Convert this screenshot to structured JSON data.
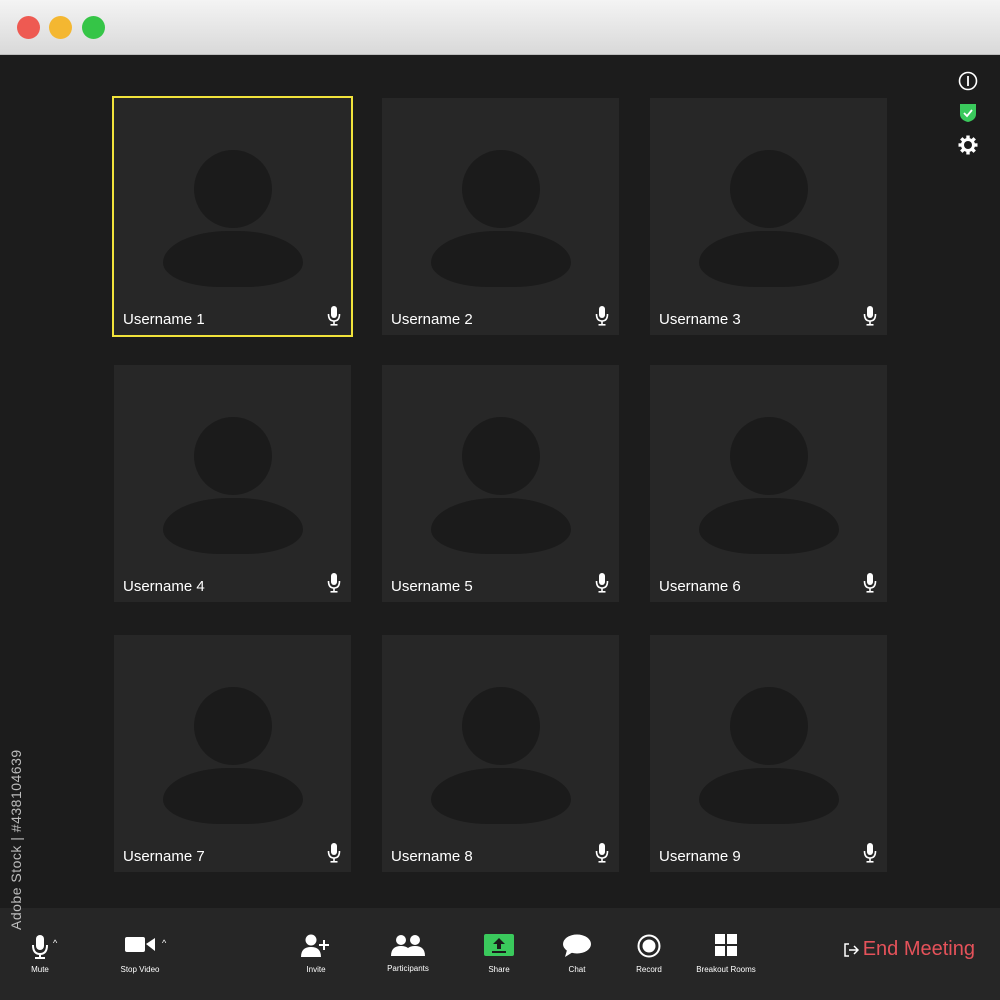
{
  "window": {
    "controls": [
      {
        "name": "close",
        "color": "#ee5a52"
      },
      {
        "name": "minimize",
        "color": "#f4b731"
      },
      {
        "name": "maximize",
        "color": "#35c547"
      }
    ]
  },
  "colors": {
    "active_speaker_border": "#f1e33b",
    "end_meeting": "#e5525a",
    "share_green": "#3ac95c"
  },
  "participants": [
    {
      "name": "Username 1",
      "active": true
    },
    {
      "name": "Username 2",
      "active": false
    },
    {
      "name": "Username 3",
      "active": false
    },
    {
      "name": "Username 4",
      "active": false
    },
    {
      "name": "Username  5",
      "active": false
    },
    {
      "name": "Username  6",
      "active": false
    },
    {
      "name": "Username 7",
      "active": false
    },
    {
      "name": "Username 8",
      "active": false
    },
    {
      "name": "Username 9",
      "active": false
    }
  ],
  "status_icons": [
    "info-icon",
    "shield-check-icon",
    "gear-icon"
  ],
  "toolbar": {
    "mute_label": "Mute",
    "stop_video_label": "Stop Video",
    "invite_label": "Invite",
    "participants_label": "Participants",
    "share_label": "Share",
    "chat_label": "Chat",
    "record_label": "Record",
    "breakout_rooms_label": "Breakout Rooms",
    "end_meeting_label": "End Meeting"
  },
  "watermark": {
    "side_text": "Adobe Stock | #438104639"
  }
}
